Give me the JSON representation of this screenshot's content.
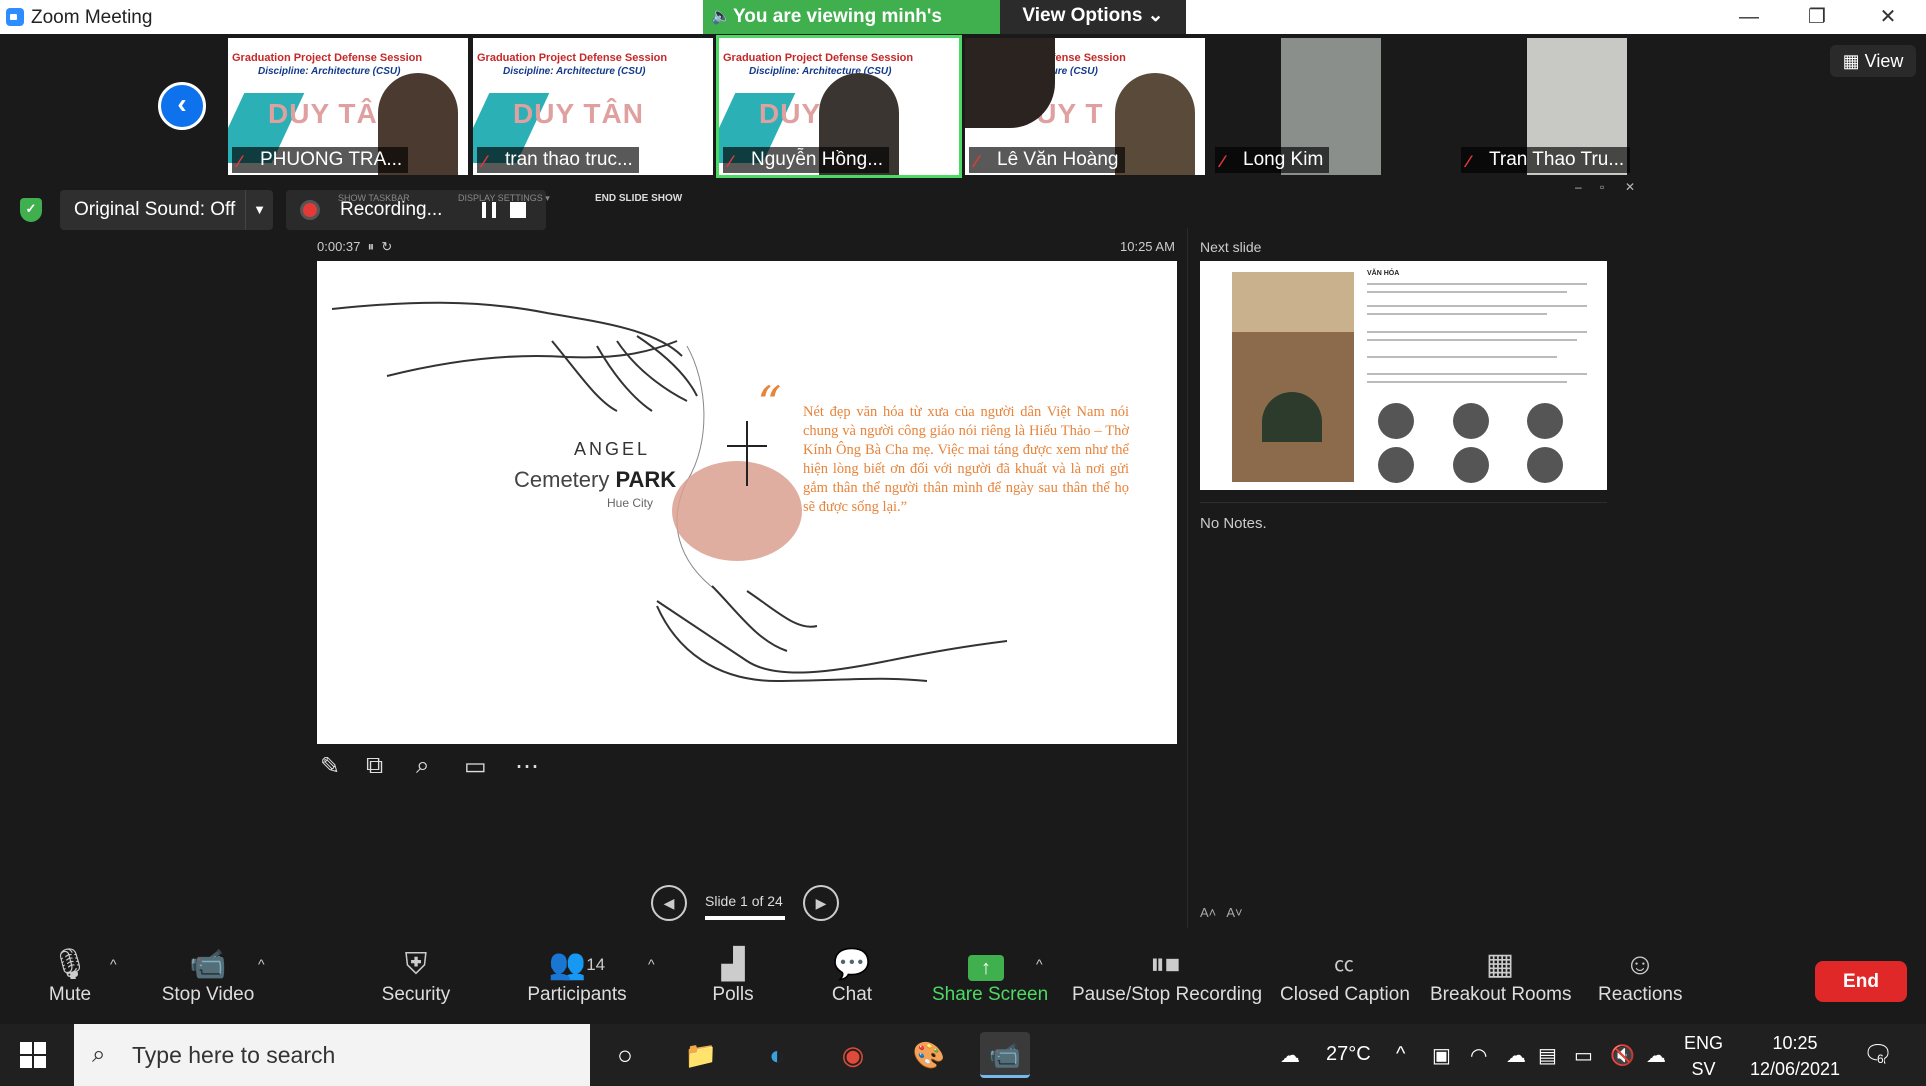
{
  "window": {
    "title": "Zoom Meeting",
    "minimize": "—",
    "restore": "❐",
    "close": "✕"
  },
  "share_banner": {
    "text": "You are viewing minh's screen",
    "view_options": "View Options ⌄"
  },
  "participants_strip": {
    "tiles": [
      {
        "name": "PHUONG TRA...",
        "session": "Graduation Project Defense Session",
        "discipline": "Discipline: Architecture (CSU)",
        "logo": "DUY TÂN"
      },
      {
        "name": "tran thao truc...",
        "session": "Graduation Project Defense Session",
        "discipline": "Discipline: Architecture (CSU)",
        "logo": "DUY TÂN"
      },
      {
        "name": "Nguyễn Hồng...",
        "session": "Graduation Project Defense Session",
        "discipline": "Discipline: Architecture (CSU)",
        "logo": "DUY TÂN"
      },
      {
        "name": "Lê Văn Hoàng",
        "session": "ct Defense Session",
        "discipline": "hitecture (CSU)",
        "logo": "DUY T"
      },
      {
        "name": "Long Kim"
      },
      {
        "name": "Tran Thao Tru..."
      }
    ],
    "view_label": "View"
  },
  "controls": {
    "original_sound": "Original Sound: Off",
    "recording_label": "Recording...",
    "show_taskbar": "SHOW TASKBAR",
    "display_settings": "DISPLAY SETTINGS ▾",
    "end_slide_show": "END SLIDE SHOW"
  },
  "presenter": {
    "timer": "0:00:37",
    "clock": "10:25 AM",
    "next_slide_label": "Next slide",
    "notes": "No Notes.",
    "slide_counter": "Slide 1 of 24",
    "next_slide_heading": "VĂN HÓA"
  },
  "slide": {
    "angel": "ANGEL",
    "cemetery": "Cemetery",
    "park": "PARK",
    "city": "Hue City",
    "quote_mark": "“",
    "quote": "Nét đẹp văn hóa từ xưa của người dân Việt Nam nói chung và người công giáo nói riêng là Hiếu Thảo – Thờ Kính Ông Bà Cha mẹ. Việc mai táng được xem như thể hiện lòng biết ơn đối với người đã khuất và là nơi gửi gắm thân thể người thân mình để ngày sau thân thể họ sẽ được sống lại.”"
  },
  "toolbar": {
    "mute": "Mute",
    "stop_video": "Stop Video",
    "security": "Security",
    "participants": "Participants",
    "participants_count": "14",
    "polls": "Polls",
    "chat": "Chat",
    "share_screen": "Share Screen",
    "pause_stop_recording": "Pause/Stop Recording",
    "closed_caption": "Closed Caption",
    "breakout_rooms": "Breakout Rooms",
    "reactions": "Reactions",
    "end": "End"
  },
  "taskbar": {
    "search_placeholder": "Type here to search",
    "temperature": "27°C",
    "lang_top": "ENG",
    "lang_bottom": "SV",
    "time": "10:25",
    "date": "12/06/2021",
    "notifications": "6"
  }
}
